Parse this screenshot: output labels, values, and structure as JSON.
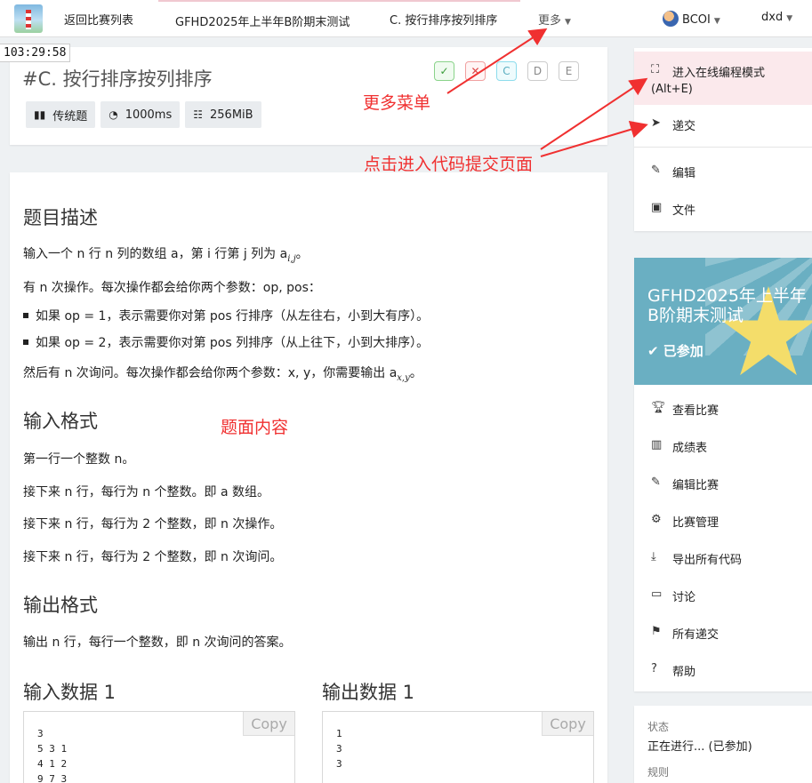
{
  "nav": {
    "back": "返回比赛列表",
    "contest": "GFHD2025年上半年B阶期末测试",
    "problem": "C. 按行排序按列排序",
    "more": "更多",
    "org": "BCOI",
    "user": "dxd"
  },
  "timer": "103:29:58",
  "header": {
    "title": "#C. 按行排序按列排序",
    "tags": [
      "传统题",
      "1000ms",
      "256MiB"
    ],
    "status_boxes": [
      "✓",
      "✕",
      "C",
      "D",
      "E"
    ]
  },
  "content": {
    "desc_title": "题目描述",
    "desc_line1": "输入一个 n 行 n 列的数组 a，第 i 行第 j 列为 a",
    "desc_line1_sub": "i,j",
    "desc_line1_end": "。",
    "desc_line2": "有 n 次操作。每次操作都会给你两个参数：op, pos：",
    "bullet1": "如果 op = 1，表示需要你对第 pos 行排序（从左往右，小到大有序）。",
    "bullet2": "如果 op = 2，表示需要你对第 pos 列排序（从上往下，小到大排序）。",
    "desc_line3": "然后有 n 次询问。每次操作都会给你两个参数：x, y，你需要输出 a",
    "desc_line3_sub": "x,y",
    "desc_line3_end": "。",
    "input_title": "输入格式",
    "input_line1": "第一行一个整数 n。",
    "input_line2": "接下来 n 行，每行为 n 个整数。即 a 数组。",
    "input_line3": "接下来 n 行，每行为 2 个整数，即 n 次操作。",
    "input_line4": "接下来 n 行，每行为 2 个整数，即 n 次询问。",
    "output_title": "输出格式",
    "output_line1": "输出 n 行，每行一个整数，即 n 次询问的答案。",
    "sample_in_title": "输入数据 1",
    "sample_out_title": "输出数据 1",
    "sample_in": "3\n5 3 1\n4 1 2\n9 7 3",
    "sample_out": "1\n3\n3",
    "copy": "Copy"
  },
  "side_menu": {
    "online_mode": "进入在线编程模式",
    "online_mode_key": "(Alt+E)",
    "submit": "递交",
    "edit": "编辑",
    "files": "文件"
  },
  "contest_banner": {
    "name": "GFHD2025年上半年B阶期末测试",
    "joined": "已参加"
  },
  "side_menu2": {
    "items": [
      "查看比赛",
      "成绩表",
      "编辑比赛",
      "比赛管理",
      "导出所有代码",
      "讨论",
      "所有递交",
      "帮助"
    ]
  },
  "side_info": {
    "status_label": "状态",
    "status_value": "正在进行... (已参加)",
    "rule_label": "规则"
  },
  "annotations": {
    "more_menu": "更多菜单",
    "submit_page": "点击进入代码提交页面",
    "content": "题面内容"
  },
  "colors": {
    "annotation": "#f03030",
    "banner": "#6aafc2",
    "highlight": "#fbe9ec"
  }
}
